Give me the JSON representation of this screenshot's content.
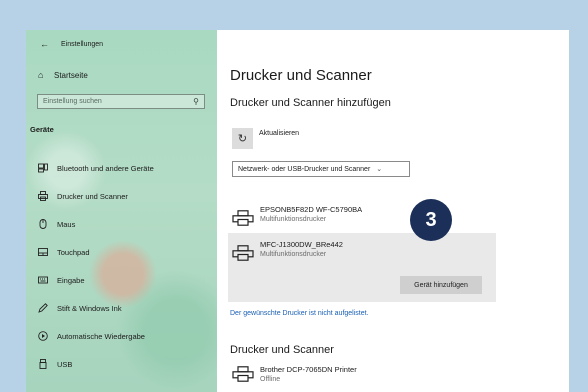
{
  "window": {
    "title": "Einstellungen"
  },
  "sidebar": {
    "home_label": "Startseite",
    "search_placeholder": "Einstellung suchen",
    "section_title": "Geräte",
    "items": [
      {
        "label": "Bluetooth und andere Geräte",
        "icon": "bluetooth-devices-icon"
      },
      {
        "label": "Drucker und Scanner",
        "icon": "printer-icon"
      },
      {
        "label": "Maus",
        "icon": "mouse-icon"
      },
      {
        "label": "Touchpad",
        "icon": "touchpad-icon"
      },
      {
        "label": "Eingabe",
        "icon": "keyboard-icon"
      },
      {
        "label": "Stift & Windows Ink",
        "icon": "pen-icon"
      },
      {
        "label": "Automatische Wiedergabe",
        "icon": "autoplay-icon"
      },
      {
        "label": "USB",
        "icon": "usb-icon"
      }
    ]
  },
  "main": {
    "page_title": "Drucker und Scanner",
    "add_section_title": "Drucker und Scanner hinzufügen",
    "refresh_label": "Aktualisieren",
    "filter_dropdown": "Netzwerk- oder USB-Drucker und Scanner",
    "found_printers": [
      {
        "name": "EPSONB5F82D WF-C5790BA",
        "type": "Multifunktionsdrucker"
      },
      {
        "name": "MFC-J1300DW_BRe442",
        "type": "Multifunktionsdrucker"
      }
    ],
    "add_device_button": "Gerät hinzufügen",
    "not_listed_link": "Der gewünschte Drucker ist nicht aufgelistet.",
    "installed_section_title": "Drucker und Scanner",
    "installed_printers": [
      {
        "name": "Brother DCP-7065DN Printer",
        "status": "Offline"
      }
    ]
  },
  "step_badge": "3",
  "colors": {
    "badge": "#1b2f59",
    "link": "#1a5fb4",
    "sidebar": "#a9d9c1",
    "frame": "#b7d2e6"
  }
}
